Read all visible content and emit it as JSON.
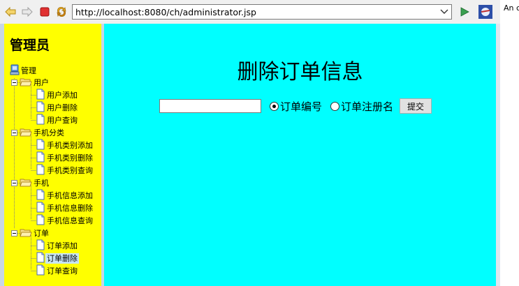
{
  "browser": {
    "url": "http://localhost:8080/ch/administrator.jsp",
    "side_text": "An c",
    "icons": {
      "back": "back-arrow-icon",
      "forward": "forward-arrow-icon",
      "stop": "stop-icon",
      "refresh": "refresh-icon",
      "dropdown": "chevron-down-icon",
      "go": "go-play-icon",
      "extra": "browser-globe-icon"
    }
  },
  "sidebar": {
    "title": "管理员",
    "root": "管理",
    "groups": [
      {
        "label": "用户",
        "items": [
          "用户添加",
          "用户删除",
          "用户查询"
        ]
      },
      {
        "label": "手机分类",
        "items": [
          "手机类别添加",
          "手机类别删除",
          "手机类别查询"
        ]
      },
      {
        "label": "手机",
        "items": [
          "手机信息添加",
          "手机信息删除",
          "手机信息查询"
        ]
      },
      {
        "label": "订单",
        "items": [
          "订单添加",
          "订单删除",
          "订单查询"
        ]
      }
    ],
    "selected": "订单删除"
  },
  "main": {
    "title": "删除订单信息",
    "input_value": "",
    "radio_options": [
      {
        "label": "订单编号",
        "checked": true
      },
      {
        "label": "订单注册名",
        "checked": false
      }
    ],
    "submit_label": "提交"
  },
  "colors": {
    "sidebar_bg": "#ffff00",
    "main_bg": "#00ffff",
    "toolbar_bg": "#f0f0f0"
  }
}
